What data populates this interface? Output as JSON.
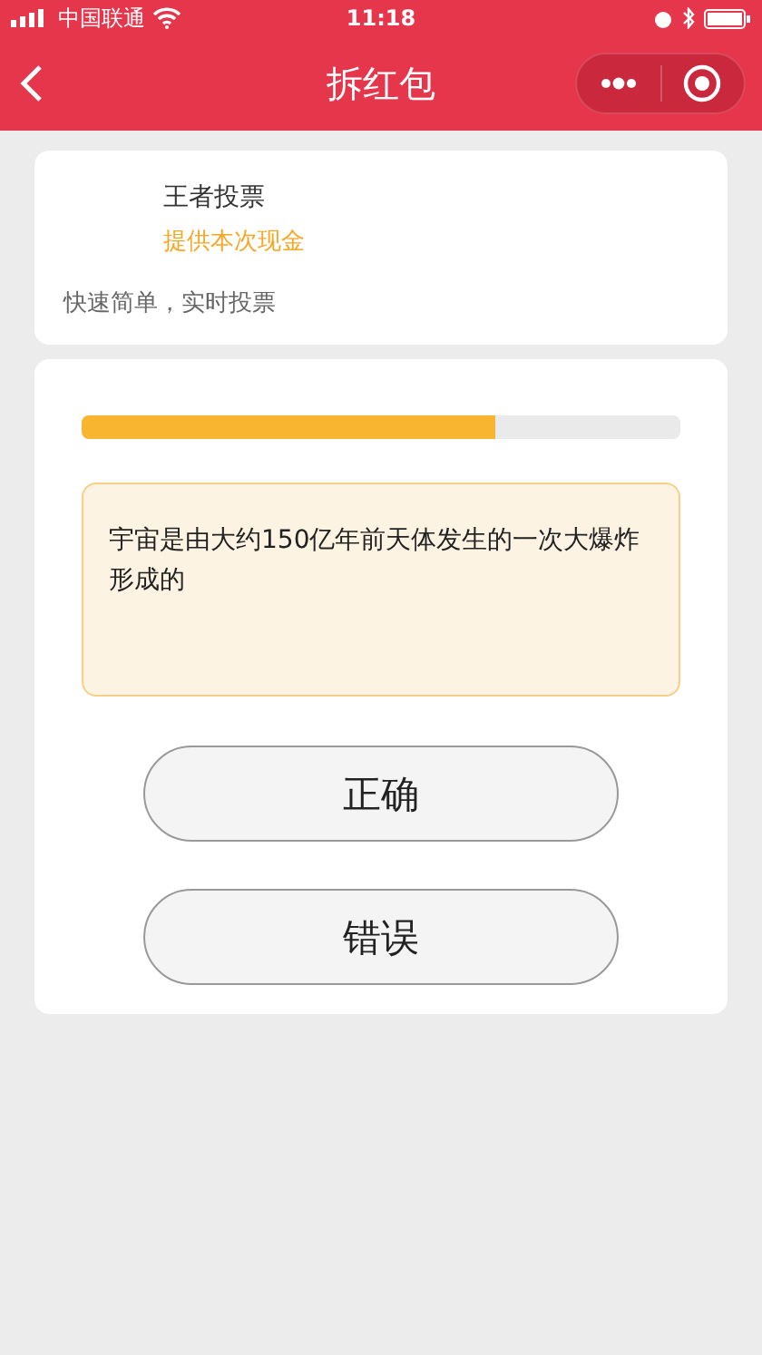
{
  "status_bar": {
    "carrier": "中国联通",
    "time": "11:18"
  },
  "nav": {
    "title": "拆红包"
  },
  "sponsor": {
    "name": "王者投票",
    "tag": "提供本次现金",
    "slogan": "快速简单，实时投票"
  },
  "quiz": {
    "progress": {
      "level": 0.69
    },
    "question": "宇宙是由大约150亿年前天体发生的一次大爆炸形成的",
    "answers": [
      {
        "label": "正确"
      },
      {
        "label": "错误"
      }
    ]
  }
}
